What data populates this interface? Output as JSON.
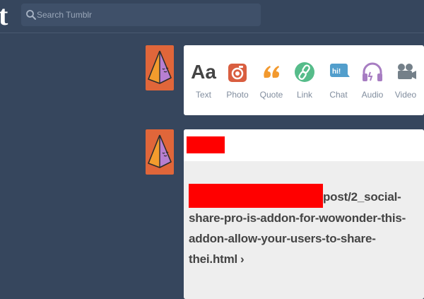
{
  "app": {
    "logo_text": "t"
  },
  "search": {
    "placeholder": "Search Tumblr"
  },
  "composer": {
    "types": [
      {
        "label": "Text",
        "icon": "text-icon",
        "glyph": "Aa",
        "color": "#444444"
      },
      {
        "label": "Photo",
        "icon": "camera-icon",
        "color": "#d95e40"
      },
      {
        "label": "Quote",
        "icon": "quote-icon",
        "glyph": "66",
        "color": "#f2992e"
      },
      {
        "label": "Link",
        "icon": "link-icon",
        "color": "#56bc8a"
      },
      {
        "label": "Chat",
        "icon": "chat-icon",
        "glyph": "hi!",
        "color": "#529ecc"
      },
      {
        "label": "Audio",
        "icon": "headphones-icon",
        "color": "#a77dc2"
      },
      {
        "label": "Video",
        "icon": "video-camera-icon",
        "color": "#748089"
      }
    ]
  },
  "post": {
    "link_text": "post/2_social-share-pro-is-addon-for-wowonder-this-addon-allow-your-users-to-share-thei.html",
    "link_chevron": "›"
  },
  "colors": {
    "background": "#36465d",
    "avatar": "#e0663a",
    "redaction": "#ff0000"
  }
}
